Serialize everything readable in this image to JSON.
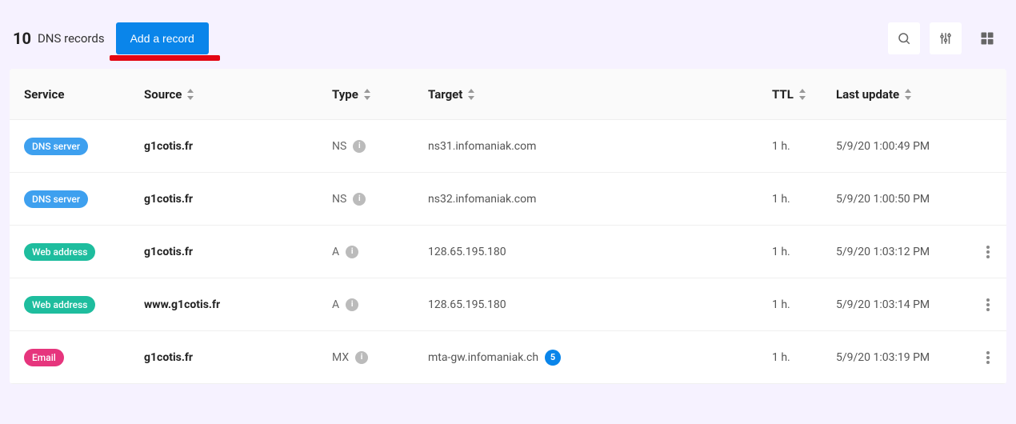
{
  "header": {
    "count": "10",
    "title": "DNS records",
    "add_label": "Add a record"
  },
  "columns": {
    "service": "Service",
    "source": "Source",
    "type": "Type",
    "target": "Target",
    "ttl": "TTL",
    "last_update": "Last update"
  },
  "rows": [
    {
      "service_label": "DNS server",
      "service_kind": "dns",
      "source": "g1cotis.fr",
      "type": "NS",
      "target": "ns31.infomaniak.com",
      "target_badge": "",
      "ttl": "1 h.",
      "last_update": "5/9/20 1:00:49 PM",
      "has_menu": false
    },
    {
      "service_label": "DNS server",
      "service_kind": "dns",
      "source": "g1cotis.fr",
      "type": "NS",
      "target": "ns32.infomaniak.com",
      "target_badge": "",
      "ttl": "1 h.",
      "last_update": "5/9/20 1:00:50 PM",
      "has_menu": false
    },
    {
      "service_label": "Web address",
      "service_kind": "web",
      "source": "g1cotis.fr",
      "type": "A",
      "target": "128.65.195.180",
      "target_badge": "",
      "ttl": "1 h.",
      "last_update": "5/9/20 1:03:12 PM",
      "has_menu": true
    },
    {
      "service_label": "Web address",
      "service_kind": "web",
      "source": "www.g1cotis.fr",
      "type": "A",
      "target": "128.65.195.180",
      "target_badge": "",
      "ttl": "1 h.",
      "last_update": "5/9/20 1:03:14 PM",
      "has_menu": true
    },
    {
      "service_label": "Email",
      "service_kind": "email",
      "source": "g1cotis.fr",
      "type": "MX",
      "target": "mta-gw.infomaniak.ch",
      "target_badge": "5",
      "ttl": "1 h.",
      "last_update": "5/9/20 1:03:19 PM",
      "has_menu": true
    }
  ]
}
